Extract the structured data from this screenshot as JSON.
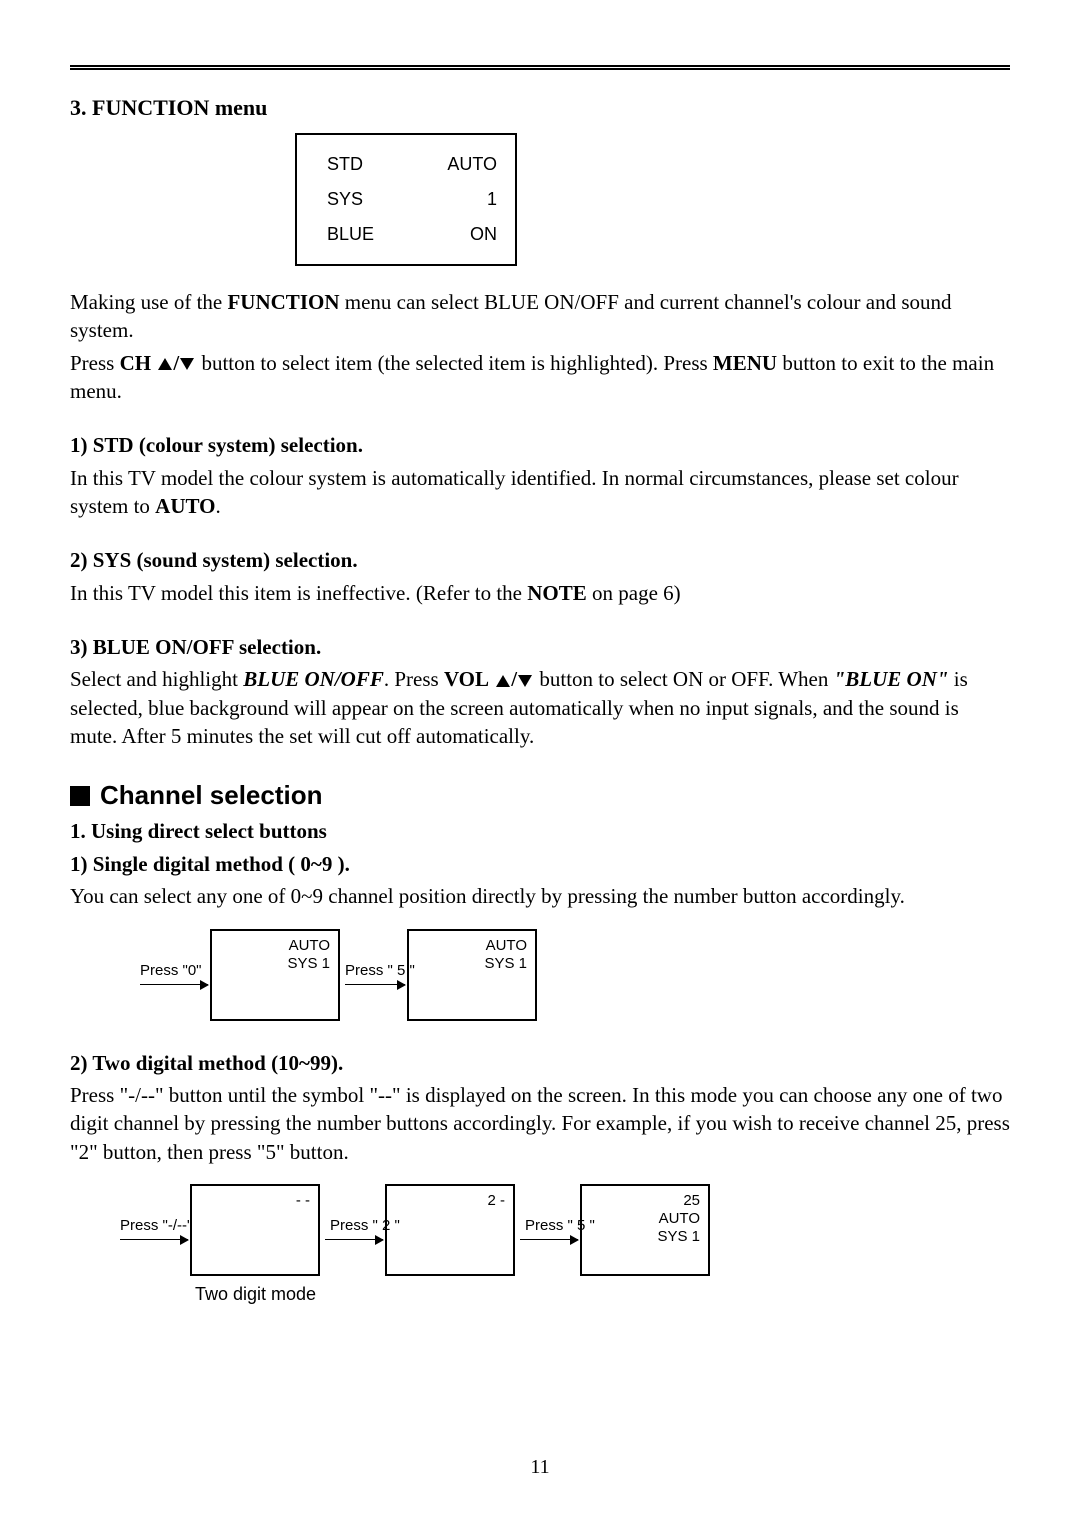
{
  "heading3": "3. FUNCTION menu",
  "menu": {
    "r1a": "STD",
    "r1b": "AUTO",
    "r2a": "SYS",
    "r2b": "1",
    "r3a": "BLUE",
    "r3b": "ON"
  },
  "p1a": "Making use of the ",
  "p1b": "FUNCTION",
  "p1c": " menu can select BLUE ON/OFF and current channel's colour and sound system.",
  "p2a": "Press ",
  "p2b": "CH",
  "p2c": "  button  to select item (the selected item is highlighted). Press ",
  "p2d": "MENU",
  "p2e": " button to exit to the main menu.",
  "s1h": "1) STD (colour system) selection.",
  "s1a": "In this TV model the colour system is automatically identified. In normal circumstances, please set colour system to ",
  "s1b": "AUTO",
  "s1c": ".",
  "s2h": "2) SYS (sound system) selection.",
  "s2a": "In this TV model this item is ineffective. (Refer to the ",
  "s2b": "NOTE",
  "s2c": " on page 6)",
  "s3h": "3) BLUE ON/OFF selection.",
  "s3a": "Select and highlight ",
  "s3b": "BLUE ON/OFF",
  "s3c": ". Press ",
  "s3d": "VOL",
  "s3e": " button to select ON or OFF. When ",
  "s3f": "\"BLUE ON\"",
  "s3g": " is selected, blue background will appear on the screen automatically when no input signals, and the sound is mute. After 5 minutes the set will cut off automatically.",
  "channelHead": "Channel selection",
  "c1": "1. Using direct select buttons",
  "c1h": "1) Single digital method ( 0~9 ).",
  "c1p": "You can select any one of 0~9 channel position directly by pressing the number button accordingly.",
  "d1": {
    "l1": "Press \"0\"",
    "s1a": "AUTO",
    "s1b": "SYS 1",
    "l2": "Press \" 5 \"",
    "s2a": "AUTO",
    "s2b": "SYS 1"
  },
  "c2h": "2) Two digital method (10~99).",
  "c2p": "Press  \"-/--\" button until the symbol \"--\" is displayed on the screen. In this mode you can choose any one of two digit channel by pressing the number buttons accordingly. For example, if you wish to receive channel 25, press \"2\" button, then press \"5\" button.",
  "d2": {
    "l1": "Press \"-/--\"",
    "s1": "- -",
    "l2": "Press \" 2 \"",
    "s2": "2 -",
    "l3": "Press \" 5 \"",
    "s3a": "25",
    "s3b": "AUTO",
    "s3c": "SYS 1",
    "cap": "Two digit mode"
  },
  "pageNum": "11"
}
